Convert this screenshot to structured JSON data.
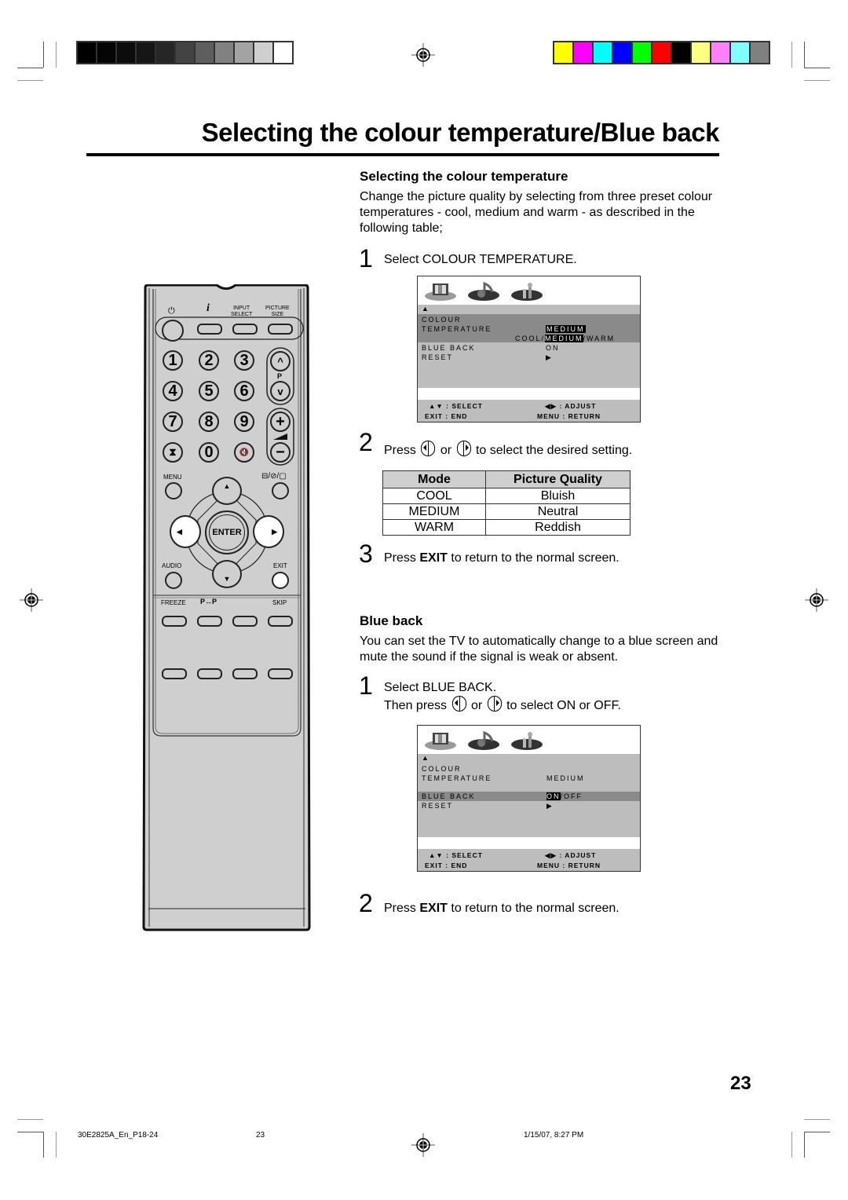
{
  "page": {
    "title": "Selecting the colour temperature/Blue back",
    "page_number": "23"
  },
  "print_marks": {
    "grayscale_bar": [
      "#000000",
      "#050505",
      "#0c0c0c",
      "#161616",
      "#262626",
      "#434343",
      "#5e5e5e",
      "#818181",
      "#a3a3a3",
      "#cfcfcf",
      "#ffffff"
    ],
    "color_bar": [
      "#ffff00",
      "#ff00ff",
      "#00ffff",
      "#0000ff",
      "#00ff00",
      "#ff0000",
      "#000000",
      "#ffff80",
      "#ff80ff",
      "#80ffff",
      "#808080"
    ]
  },
  "colour_temperature": {
    "heading": "Selecting the colour temperature",
    "intro": "Change the picture quality by selecting from three preset colour temperatures - cool, medium and warm - as described in the following table;",
    "step1": {
      "num": "1",
      "text": "Select COLOUR TEMPERATURE."
    },
    "step2": {
      "num": "2",
      "pre": "Press",
      "or": "or",
      "post": "to select the desired setting."
    },
    "step3": {
      "num": "3",
      "pre": "Press",
      "bold": "EXIT",
      "post": "to return to the normal screen."
    },
    "table": {
      "headers": [
        "Mode",
        "Picture Quality"
      ],
      "rows": [
        [
          "COOL",
          "Bluish"
        ],
        [
          "MEDIUM",
          "Neutral"
        ],
        [
          "WARM",
          "Reddish"
        ]
      ]
    }
  },
  "osd1": {
    "up_arrow": "▲",
    "item1_line1": "COLOUR",
    "item1_line2": "TEMPERATURE",
    "item1_value": "MEDIUM",
    "options_pre": "COOL/",
    "options_sel": "MEDIUM",
    "options_post": "/WARM",
    "item2": "BLUE BACK",
    "item2_value": "ON",
    "item3": "RESET",
    "item3_value": "▶",
    "foot_select": "▲▼ : SELECT",
    "foot_adjust": "◀▶ : ADJUST",
    "foot_exit": "EXIT : END",
    "foot_menu": "MENU : RETURN"
  },
  "blue_back": {
    "heading": "Blue back",
    "intro": "You can set the TV to automatically change to a blue screen and mute the sound if the signal is weak or absent.",
    "step1": {
      "num": "1",
      "line1": "Select BLUE BACK.",
      "pre": "Then press",
      "or": "or",
      "post": "to select ON or OFF."
    },
    "step2": {
      "num": "2",
      "pre": "Press",
      "bold": "EXIT",
      "post": "to return to the normal screen."
    }
  },
  "osd2": {
    "up_arrow": "▲",
    "item1_line1": "COLOUR",
    "item1_line2": "TEMPERATURE",
    "item1_value": "MEDIUM",
    "item2": "BLUE BACK",
    "item2_sel": "ON",
    "item2_rest": "/OFF",
    "item3": "RESET",
    "item3_value": "▶",
    "foot_select": "▲▼ : SELECT",
    "foot_adjust": "◀▶ : ADJUST",
    "foot_exit": "EXIT : END",
    "foot_menu": "MENU : RETURN"
  },
  "remote": {
    "power_symbol": "⏻",
    "info_label": "i",
    "input_select": "INPUT\nSELECT",
    "picture_size": "PICTURE\nSIZE",
    "digits": [
      "1",
      "2",
      "3",
      "4",
      "5",
      "6",
      "7",
      "8",
      "9",
      "0"
    ],
    "timer_symbol": "⧗",
    "mute_symbol": "🔇",
    "p_label": "P",
    "ch_up": "^",
    "ch_down": "v",
    "vol_plus": "+",
    "vol_minus": "−",
    "menu": "MENU",
    "text_mode": "⊟/⊘/▢",
    "enter": "ENTER",
    "up": "▲",
    "down": "▼",
    "left": "◀",
    "right": "▶",
    "audio": "AUDIO",
    "exit": "EXIT",
    "freeze": "FREEZE",
    "p_swap": "P↔P",
    "skip": "SKIP"
  },
  "footer": {
    "file": "30E2825A_En_P18-24",
    "page": "23",
    "timestamp": "1/15/07, 8:27 PM"
  }
}
